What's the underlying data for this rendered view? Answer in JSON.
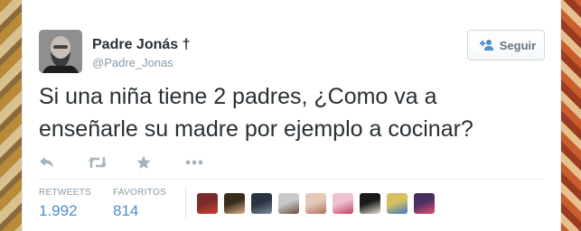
{
  "user": {
    "name": "Padre Jonás †",
    "handle": "@Padre_Jonas"
  },
  "follow_button": {
    "label": "Seguir"
  },
  "tweet": {
    "line1": "Si una niña tiene 2 padres, ¿Como va a",
    "line2": "enseñarle su madre por ejemplo a cocinar?"
  },
  "stats": {
    "retweets_label": "RETWEETS",
    "retweets_value": "1.992",
    "favorites_label": "FAVORITOS",
    "favorites_value": "814"
  },
  "icons": [
    "reply-icon",
    "retweet-icon",
    "favorite-icon",
    "more-icon",
    "follow-user-icon"
  ],
  "colors": {
    "link_blue": "#4c8fc9",
    "text": "#292f33",
    "muted": "#8899a6",
    "icon_gray": "#a6b3bd"
  },
  "favoriter_avatars": [
    {
      "c1": "#7a2a2a",
      "c2": "#d04030"
    },
    {
      "c1": "#3a2a1a",
      "c2": "#d9b28a"
    },
    {
      "c1": "#2a3240",
      "c2": "#7d8a98"
    },
    {
      "c1": "#c9c9c9",
      "c2": "#6a4a3a"
    },
    {
      "c1": "#e4c9b8",
      "c2": "#b07060"
    },
    {
      "c1": "#f0c0d0",
      "c2": "#c04060"
    },
    {
      "c1": "#1a1a1a",
      "c2": "#e8e0d0"
    },
    {
      "c1": "#d8c060",
      "c2": "#3a7ac0"
    },
    {
      "c1": "#4a3060",
      "c2": "#e05070"
    }
  ]
}
